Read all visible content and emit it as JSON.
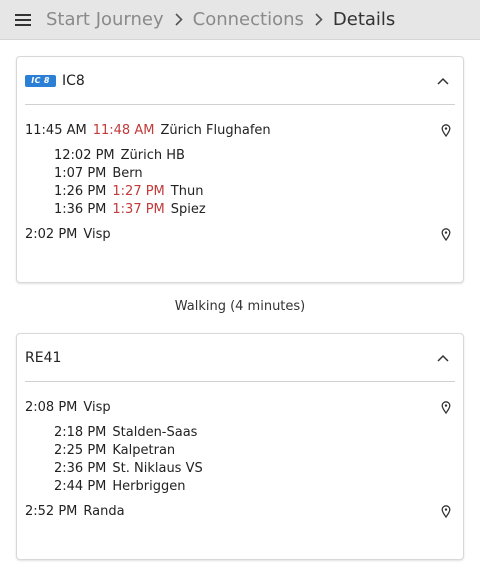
{
  "breadcrumb": {
    "items": [
      "Start Journey",
      "Connections"
    ],
    "current": "Details"
  },
  "journey": {
    "legs": [
      {
        "line": "IC8",
        "badge": "IC 8",
        "departure": {
          "time": "11:45 AM",
          "delay": "11:48 AM",
          "stop": "Zürich Flughafen"
        },
        "intermediate": [
          {
            "time": "12:02 PM",
            "delay": "",
            "stop": "Zürich HB"
          },
          {
            "time": "1:07 PM",
            "delay": "",
            "stop": "Bern"
          },
          {
            "time": "1:26 PM",
            "delay": "1:27 PM",
            "stop": "Thun"
          },
          {
            "time": "1:36 PM",
            "delay": "1:37 PM",
            "stop": "Spiez"
          }
        ],
        "arrival": {
          "time": "2:02 PM",
          "delay": "",
          "stop": "Visp"
        }
      },
      {
        "line": "RE41",
        "departure": {
          "time": "2:08 PM",
          "delay": "",
          "stop": "Visp"
        },
        "intermediate": [
          {
            "time": "2:18 PM",
            "delay": "",
            "stop": "Stalden-Saas"
          },
          {
            "time": "2:25 PM",
            "delay": "",
            "stop": "Kalpetran"
          },
          {
            "time": "2:36 PM",
            "delay": "",
            "stop": "St. Niklaus VS"
          },
          {
            "time": "2:44 PM",
            "delay": "",
            "stop": "Herbriggen"
          }
        ],
        "arrival": {
          "time": "2:52 PM",
          "delay": "",
          "stop": "Randa"
        }
      }
    ],
    "walking": "Walking (4 minutes)"
  },
  "icons": {
    "menu": "hamburger-menu-icon",
    "separator": "chevron-right-icon",
    "collapse": "chevron-up-icon",
    "location": "map-pin-icon"
  },
  "colors": {
    "delay": "#c23a3a",
    "badge": "#2b7fd4",
    "header": "#e6e6e6"
  }
}
